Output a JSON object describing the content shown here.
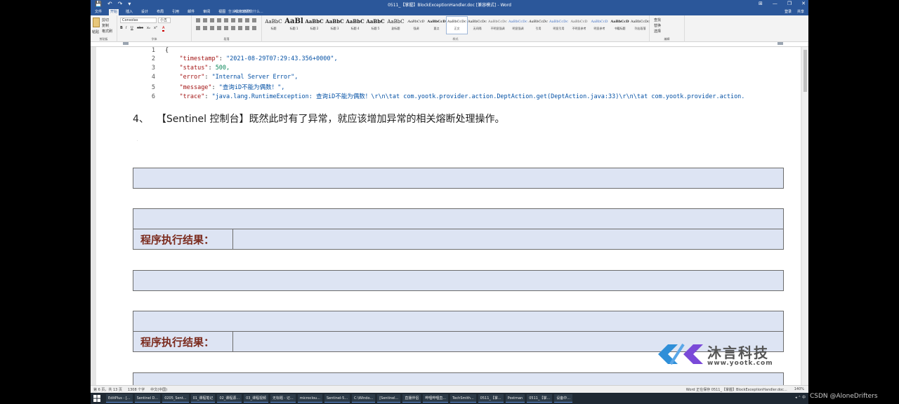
{
  "window": {
    "title": "0511_【掌握】BlockExceptionHandler.doc [兼容模式] - Word",
    "quick_access": [
      "💾",
      "↶",
      "↷",
      "▾"
    ],
    "controls": [
      "⊞",
      "—",
      "❐",
      "✕"
    ]
  },
  "tabs": {
    "items": [
      "文件",
      "开始",
      "插入",
      "设计",
      "布局",
      "引用",
      "邮件",
      "审阅",
      "视图",
      "ACROBAT"
    ],
    "active": "开始",
    "tell_me": "告诉我您想要做什么...",
    "right": [
      "登录",
      "共享"
    ]
  },
  "ribbon": {
    "groups": [
      "剪贴板",
      "字体",
      "段落",
      "样式",
      "编辑"
    ],
    "clipboard": [
      "粘贴",
      "剪切",
      "复制",
      "格式刷"
    ],
    "font": {
      "name": "Consolas",
      "size": "小五",
      "buttons": [
        "B",
        "I",
        "U",
        "abc",
        "x₂",
        "x²",
        "A"
      ]
    },
    "styles": [
      {
        "preview": "AaBbC",
        "name": "标题"
      },
      {
        "preview": "AaBl",
        "name": "标题 1"
      },
      {
        "preview": "AaBbC",
        "name": "标题 2"
      },
      {
        "preview": "AaBbC",
        "name": "标题 3"
      },
      {
        "preview": "AaBbC",
        "name": "标题 4"
      },
      {
        "preview": "AaBbC",
        "name": "标题 5"
      },
      {
        "preview": "AaBbC",
        "name": "副标题"
      },
      {
        "preview": "AaBbCcD",
        "name": "强调"
      },
      {
        "preview": "AaBbCcD",
        "name": "要点"
      },
      {
        "preview": "AaBbCcDc",
        "name": "正文"
      },
      {
        "preview": "AaBbCcDc",
        "name": "无间隔"
      },
      {
        "preview": "AaBbCcDc",
        "name": "不明显强调"
      },
      {
        "preview": "AaBbCcDc",
        "name": "明显强调"
      },
      {
        "preview": "AaBbCcDc",
        "name": "引用"
      },
      {
        "preview": "AaBbCcDc",
        "name": "明显引用"
      },
      {
        "preview": "AaBbCcD",
        "name": "不明显参考"
      },
      {
        "preview": "AaBbCcD",
        "name": "明显参考"
      },
      {
        "preview": "AaBbCcD",
        "name": "书籍标题"
      },
      {
        "preview": "AaBbCcDc",
        "name": "列出段落"
      }
    ],
    "editing": [
      "查找",
      "替换",
      "选择"
    ]
  },
  "code": {
    "lines": [
      {
        "n": "1",
        "text": "{"
      },
      {
        "n": "2",
        "key": "\"timestamp\"",
        "value": "\"2021-08-29T07:29:43.356+0000\","
      },
      {
        "n": "3",
        "key": "\"status\"",
        "value": "500,"
      },
      {
        "n": "4",
        "key": "\"error\"",
        "value": "\"Internal Server Error\","
      },
      {
        "n": "5",
        "key": "\"message\"",
        "value": "\"查询iD不能为偶数！\","
      },
      {
        "n": "6",
        "key": "\"trace\"",
        "value": "\"java.lang.RuntimeException: 查询iD不能为偶数！\\r\\n\\tat com.yootk.provider.action.DeptAction.get(DeptAction.java:33)\\r\\n\\tat com.yootk.provider.action."
      }
    ]
  },
  "heading": {
    "number": "4、",
    "text": "【Sentinel 控制台】既然此时有了异常，就应该增加异常的相关熔断处理操作。"
  },
  "result_label": "程序执行结果：",
  "watermark": {
    "name": "沐言科技",
    "url": "www.yootk.com"
  },
  "status": {
    "left": [
      "第 6 页，共 13 页",
      "1308 个字",
      "中文(中国)"
    ],
    "right": "Word 正在保存 0511_【掌握】BlockExceptionHandler.doc...",
    "zoom": "140%"
  },
  "taskbar": {
    "items": [
      "EditPlus - [...",
      "Sentinel D...",
      "0205_Sent...",
      "01_课程笔记",
      "02_课程源...",
      "03_课程视频",
      "无标题 - 记...",
      "microclou...",
      "Sentinel-5...",
      "C:\\Windo...",
      "[Sentinel...",
      "直播伴侣",
      "哔哩哔哩直...",
      "TechSmith...",
      "0511_【掌...",
      "Postman",
      "0511_【掌...",
      "设备中..."
    ],
    "clock": "◂ ⌃ 中"
  },
  "csdn": "CSDN @AloneDrifters"
}
